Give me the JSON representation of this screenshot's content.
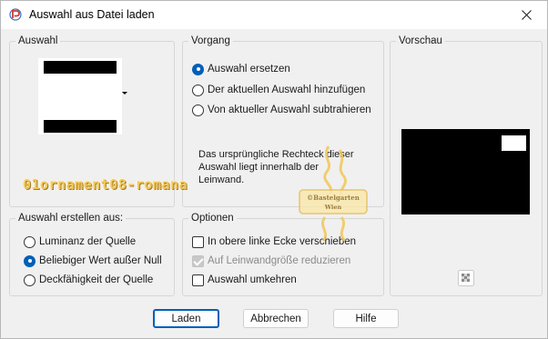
{
  "window": {
    "title": "Auswahl aus Datei laden"
  },
  "icons": {
    "app": "psp-icon",
    "close": "close-icon",
    "transparency": "transparency-checker-icon",
    "dropdown": "chevron-down-icon"
  },
  "auswahl": {
    "label": "Auswahl"
  },
  "vorgang": {
    "label": "Vorgang",
    "options": [
      {
        "label": "Auswahl ersetzen",
        "selected": true
      },
      {
        "label": "Der aktuellen Auswahl hinzufügen",
        "selected": false
      },
      {
        "label": "Von aktueller Auswahl subtrahieren",
        "selected": false
      }
    ],
    "description": "Das ursprüngliche Rechteck dieser Auswahl liegt innerhalb der Leinwand."
  },
  "vorschau": {
    "label": "Vorschau"
  },
  "erstellen": {
    "label": "Auswahl erstellen aus:",
    "options": [
      {
        "label": "Luminanz der Quelle",
        "selected": false
      },
      {
        "label": "Beliebiger Wert außer Null",
        "selected": true
      },
      {
        "label": "Deckfähigkeit der Quelle",
        "selected": false
      }
    ]
  },
  "optionen": {
    "label": "Optionen",
    "checks": [
      {
        "label": "In obere linke Ecke verschieben",
        "checked": false,
        "disabled": false
      },
      {
        "label": "Auf Leinwandgröße reduzieren",
        "checked": true,
        "disabled": true
      },
      {
        "label": "Auswahl umkehren",
        "checked": false,
        "disabled": false
      }
    ]
  },
  "buttons": {
    "load": "Laden",
    "cancel": "Abbrechen",
    "help": "Hilfe"
  },
  "watermark": {
    "name": "01ornament08-romana",
    "logo_line1": "©Bastelgarten",
    "logo_line2": "Wien"
  },
  "colors": {
    "accent": "#005fb8",
    "watermark_gold": "#f2c85a"
  }
}
